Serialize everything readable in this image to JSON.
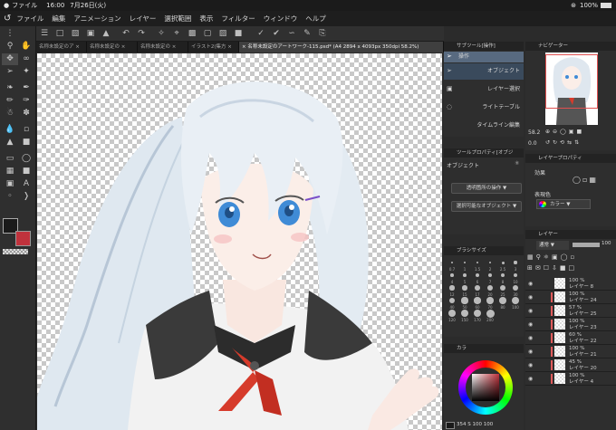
{
  "status": {
    "app": "ファイル",
    "time": "16:00",
    "date": "7月26日(火)",
    "battery": "100%"
  },
  "menu": [
    "ファイル",
    "編集",
    "アニメーション",
    "レイヤー",
    "選択範囲",
    "表示",
    "フィルター",
    "ウィンドウ",
    "ヘルプ"
  ],
  "tabs": [
    "名称未設定のア",
    "名称未設定の",
    "名称未設定の",
    "イラスト2(集方",
    "名称未設定のアートワーク-115.psd* (A4 2894 x 4093px 350dpi 58.2%)"
  ],
  "subtool": {
    "title": "サブツール[操作]",
    "items": [
      "操作",
      "オブジェクト",
      "レイヤー選択",
      "ライトテーブル",
      "タイムライン編集"
    ]
  },
  "navigator": {
    "title": "ナビゲーター",
    "zoom": "58.2",
    "angle": "0.0"
  },
  "toolprop": {
    "title": "ツールプロパティ[オブジ",
    "sub": "オブジェクト",
    "opt1": "透明箇所の操作",
    "opt2": "選択可能なオブジェクト"
  },
  "layerprop": {
    "title": "レイヤープロパティ",
    "effect": "効果",
    "color_label": "表現色",
    "color_value": "カラー"
  },
  "brushsize": {
    "title": "ブラシサイズ",
    "sizes": [
      "0.7",
      "1",
      "1.5",
      "2",
      "2.5",
      "3",
      "4",
      "5",
      "6",
      "7",
      "8",
      "10",
      "12",
      "15",
      "17",
      "20",
      "25",
      "30",
      "40",
      "50",
      "60",
      "70",
      "80",
      "100",
      "120",
      "150",
      "170",
      "200"
    ]
  },
  "layers": {
    "title": "レイヤー",
    "blend": "通常",
    "opacity": "100",
    "rows": [
      {
        "pct": "100 %",
        "name": "レイヤー 8"
      },
      {
        "pct": "100 %",
        "name": "レイヤー 24"
      },
      {
        "pct": "57 %",
        "name": "レイヤー 25"
      },
      {
        "pct": "100 %",
        "name": "レイヤー 23"
      },
      {
        "pct": "60 %",
        "name": "レイヤー 22"
      },
      {
        "pct": "100 %",
        "name": "レイヤー 21"
      },
      {
        "pct": "45 %",
        "name": "レイヤー 20"
      },
      {
        "pct": "100 %",
        "name": "レイヤー 4"
      }
    ]
  },
  "colorpanel": {
    "title": "カラ",
    "readout": "354",
    "values": "100 100"
  },
  "colors": {
    "main": "#1a1a1a",
    "sub": "#c0323c",
    "accent": "#6b8bb5"
  }
}
